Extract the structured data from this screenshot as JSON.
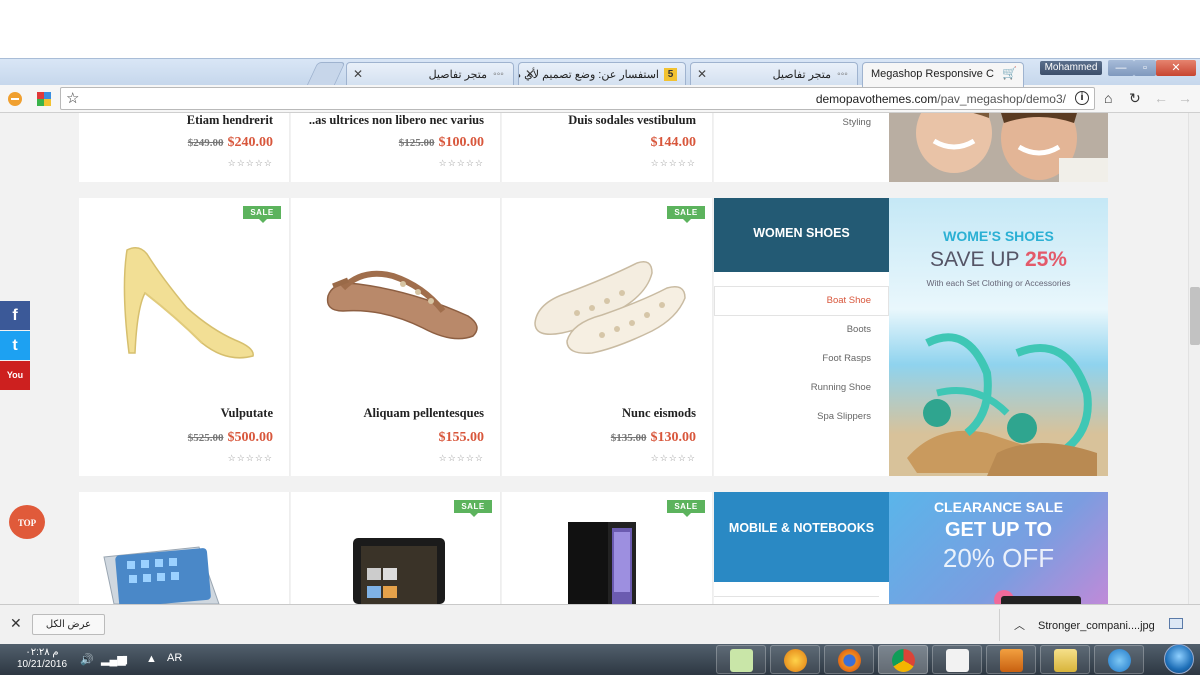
{
  "browser": {
    "tabs": [
      {
        "title": "Megashop Responsive C",
        "active": true,
        "favicon": "cart-icon"
      },
      {
        "title": "متجر تفاصيل",
        "active": false,
        "favicon": "loading-icon"
      },
      {
        "title": "استفسار عن: وضع تصميم لأي م",
        "active": false,
        "favicon": "5"
      },
      {
        "title": "متجر تفاصيل",
        "active": false,
        "favicon": "loading-icon"
      }
    ],
    "user": "Mohammed",
    "url_domain": "demopavothemes.com",
    "url_path": "/pav_megashop/demo3/",
    "window_buttons": {
      "minimize": "—",
      "maximize": "▫",
      "close": "✕"
    }
  },
  "page": {
    "row1": {
      "products": [
        {
          "name": "Etiam hendrerit",
          "old_price": "$249.00",
          "price": "$240.00"
        },
        {
          "name": "..as ultrices non libero nec varius",
          "old_price": "$125.00",
          "price": "$100.00"
        },
        {
          "name": "Duis sodales vestibulum",
          "old_price": "",
          "price": "$144.00"
        }
      ],
      "category_item": "Styling"
    },
    "row2": {
      "products": [
        {
          "name": "Vulputate",
          "old_price": "$525.00",
          "price": "$500.00",
          "sale": "SALE"
        },
        {
          "name": "Aliquam pellentesques",
          "old_price": "",
          "price": "$155.00",
          "sale": ""
        },
        {
          "name": "Nunc eismods",
          "old_price": "$135.00",
          "price": "$130.00",
          "sale": "SALE"
        }
      ],
      "category": {
        "title": "WOMEN SHOES",
        "items": [
          "Boat Shoe",
          "Boots",
          "Foot Rasps",
          "Running Shoe",
          "Spa Slippers"
        ]
      },
      "banner": {
        "line1": "WOME'S SHOES",
        "line2": "SAVE UP",
        "percent": "25%",
        "line3": "With each Set Clothing or Accessories"
      }
    },
    "row3": {
      "sale_labels": [
        "SALE",
        "SALE"
      ],
      "category": {
        "title": "MOBILE & NOTEBOOKS"
      },
      "banner": {
        "line1": "CLEARANCE SALE",
        "line2": "GET UP TO",
        "line3": "20% OFF"
      }
    },
    "stars": "☆☆☆☆☆",
    "social": [
      {
        "icon": "facebook-icon",
        "glyph": "f",
        "color": "#3b5998"
      },
      {
        "icon": "twitter-icon",
        "glyph": "t",
        "color": "#1da1f2"
      },
      {
        "icon": "youtube-icon",
        "glyph": "You",
        "color": "#cd201f"
      }
    ],
    "top_button": "TOP",
    "colors": {
      "accent": "#d8573c",
      "sale": "#5cb35d",
      "women_header": "#235a74",
      "mobile_header": "#2a89c4"
    }
  },
  "downloads": {
    "show_all": "عرض الكل",
    "file": "Stronger_compani....jpg"
  },
  "taskbar": {
    "time": "۰۲:۲۸ م",
    "date": "10/21/2016",
    "lang": "AR"
  }
}
